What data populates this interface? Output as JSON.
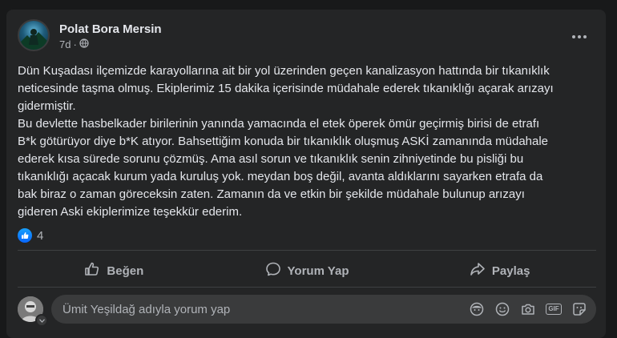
{
  "post": {
    "author": "Polat Bora Mersin",
    "time": "7d",
    "separator": "·",
    "privacy_icon": "globe-icon",
    "more_icon": "more-options-icon",
    "text_lines": [
      "Dün Kuşadası ilçemizde karayollarına ait bir yol üzerinden geçen kanalizasyon hattında bir tıkanıklık",
      "neticesinde taşma olmuş. Ekiplerimiz 15 dakika içerisinde müdahale ederek tıkanıklığı açarak arızayı",
      "gidermiştir.",
      "Bu devlette hasbelkader birilerinin yanında yamacında el etek öperek ömür geçirmiş birisi de etrafı",
      "B*k götürüyor diye b*K atıyor. Bahsettiğim konuda bir tıkanıklık oluşmuş ASKİ zamanında müdahale",
      "ederek kısa sürede sorunu çözmüş. Ama asıl sorun ve tıkanıklık senin zihniyetinde bu pisliği bu",
      "tıkanıklığı açacak kurum yada kuruluş yok. meydan boş değil, avanta aldıklarını sayarken etrafa da",
      "bak biraz o zaman göreceksin zaten. Zamanın da ve etkin bir şekilde müdahale bulunup arızayı",
      "gideren Aski ekiplerimize teşekkür ederim."
    ],
    "reactions": {
      "icon": "like-reaction-icon",
      "count": "4"
    }
  },
  "actions": {
    "like_label": "Beğen",
    "comment_label": "Yorum Yap",
    "share_label": "Paylaş"
  },
  "comment": {
    "placeholder": "Ümit Yeşildağ adıyla yorum yap",
    "tools": [
      "avatar-sticker-icon",
      "emoji-icon",
      "camera-icon",
      "gif-icon",
      "sticker-icon"
    ],
    "gif_label": "GIF"
  },
  "colors": {
    "page_bg": "#18191a",
    "card_bg": "#242526",
    "text": "#e4e6eb",
    "secondary_text": "#b0b3b8",
    "like_blue": "#0866ff"
  }
}
